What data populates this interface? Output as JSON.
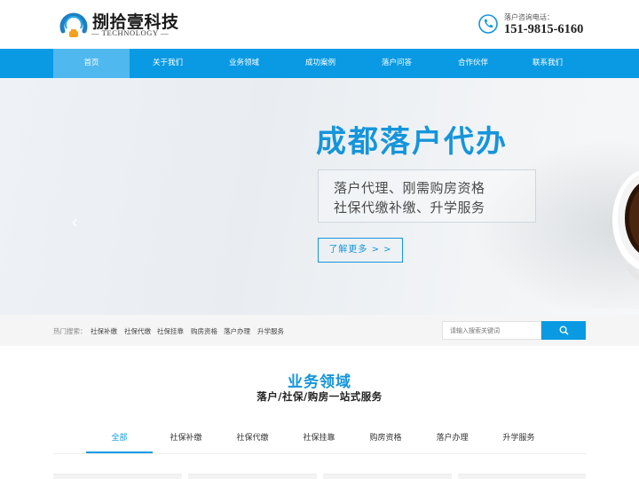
{
  "header": {
    "logo_title": "捌拾壹科技",
    "logo_subtitle": "— TECHNOLOGY —",
    "phone_label": "落户咨询电话：",
    "phone_number": "151-9815-6160"
  },
  "nav": {
    "items": [
      {
        "label": "首页",
        "active": true
      },
      {
        "label": "关于我们"
      },
      {
        "label": "业务领域"
      },
      {
        "label": "成功案例"
      },
      {
        "label": "落户问答"
      },
      {
        "label": "合作伙伴"
      },
      {
        "label": "联系我们"
      }
    ]
  },
  "banner": {
    "title": "成都落户代办",
    "line1": "落户代理、刚需购房资格",
    "line2": "社保代缴补缴、升学服务",
    "button_label": "了解更多 > >",
    "prev_arrow": "‹"
  },
  "search": {
    "hot_label": "热门搜索：",
    "hot_items": [
      "社保补缴",
      "社保代缴",
      "社保挂靠",
      "购房资格",
      "落户办理",
      "升学服务"
    ],
    "placeholder": "请输入搜索关键词"
  },
  "section": {
    "title": "业务领域",
    "subtitle": "落户/社保/购房一站式服务",
    "tabs": [
      {
        "label": "全部",
        "active": true
      },
      {
        "label": "社保补缴"
      },
      {
        "label": "社保代缴"
      },
      {
        "label": "社保挂靠"
      },
      {
        "label": "购房资格"
      },
      {
        "label": "落户办理"
      },
      {
        "label": "升学服务"
      }
    ]
  },
  "colors": {
    "brand_blue": "#0a9ae3",
    "nav_active": "#4fb8ef",
    "title_blue": "#1595db"
  }
}
